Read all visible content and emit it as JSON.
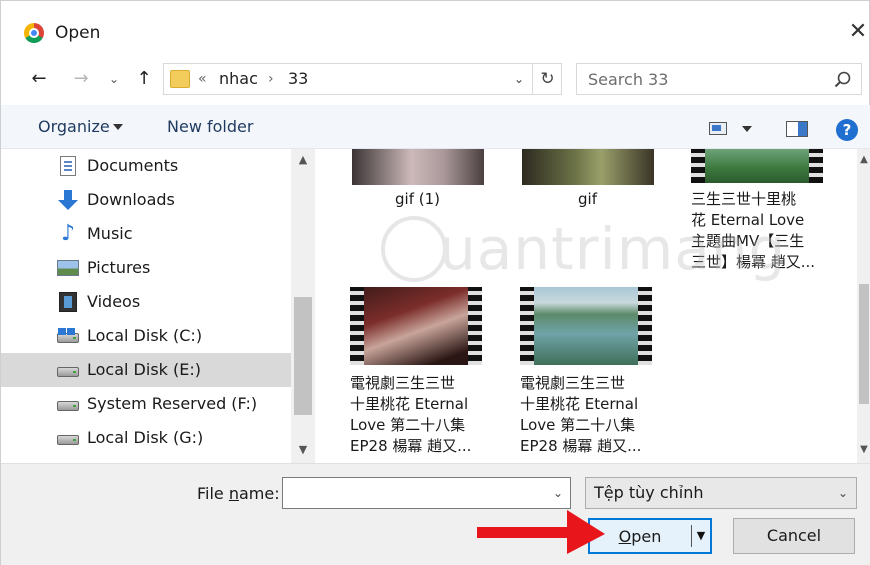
{
  "window": {
    "title": "Open"
  },
  "navigation": {
    "path": [
      "nhac",
      "33"
    ],
    "overflow_marker": "«",
    "separator": "›",
    "search_placeholder": "Search 33"
  },
  "toolbar": {
    "organize_label": "Organize",
    "new_folder_label": "New folder",
    "help_label": "?"
  },
  "nav_pane": {
    "items": [
      {
        "label": "Documents",
        "icon": "documents-icon"
      },
      {
        "label": "Downloads",
        "icon": "downloads-icon"
      },
      {
        "label": "Music",
        "icon": "music-icon"
      },
      {
        "label": "Pictures",
        "icon": "pictures-icon"
      },
      {
        "label": "Videos",
        "icon": "videos-icon"
      },
      {
        "label": "Local Disk (C:)",
        "icon": "windows-disk-icon"
      },
      {
        "label": "Local Disk (E:)",
        "icon": "disk-icon",
        "selected": true
      },
      {
        "label": "System Reserved (F:)",
        "icon": "disk-icon"
      },
      {
        "label": "Local Disk (G:)",
        "icon": "disk-icon"
      }
    ]
  },
  "files": [
    {
      "name": "gif (1)",
      "type": "image"
    },
    {
      "name": "gif",
      "type": "image"
    },
    {
      "name": "三生三世十里桃\n花 Eternal Love\n主題曲MV【三生\n三世】楊冪 趙又...",
      "type": "video"
    },
    {
      "name": "電視劇三生三世\n十里桃花 Eternal\nLove 第二十八集\nEP28 楊冪 趙又...",
      "type": "video"
    },
    {
      "name": "電視劇三生三世\n十里桃花 Eternal\nLove 第二十八集\nEP28 楊冪 趙又...",
      "type": "video"
    }
  ],
  "watermark": {
    "text": "uantrimang"
  },
  "footer": {
    "file_name_label_prefix": "File ",
    "file_name_label_underlined": "n",
    "file_name_label_suffix": "ame:",
    "file_name_value": "",
    "file_type_value": "Tệp tùy chỉnh",
    "open_label_underlined": "O",
    "open_label_rest": "pen",
    "cancel_label": "Cancel"
  },
  "colors": {
    "accent": "#0078d7",
    "annotation_arrow": "#e8151b",
    "selected_row": "#d9d9d9",
    "toolbar_bg": "#f3f6fb"
  }
}
